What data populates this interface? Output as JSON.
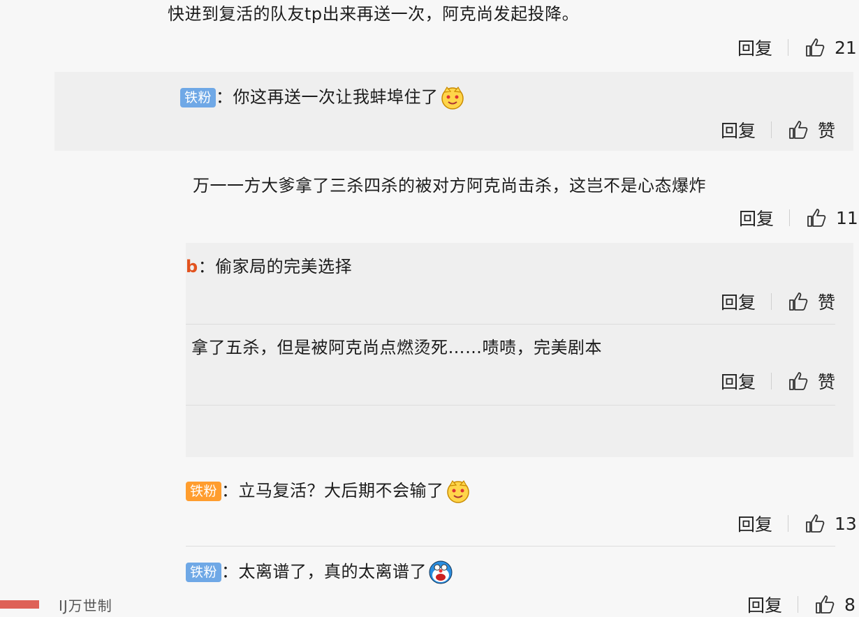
{
  "comments": [
    {
      "text": "快进到复活的队友tp出来再送一次，阿克尚发起投降。",
      "reply": "回复",
      "likes": "21"
    },
    {
      "badge": "铁粉",
      "text": "：你这再送一次让我蚌埠住了",
      "reply": "回复",
      "likes": "赞"
    },
    {
      "text": "万一一方大爹拿了三杀四杀的被对方阿克尚击杀，这岂不是心态爆炸",
      "reply": "回复",
      "likes": "11"
    },
    {
      "prefix": "b",
      "text": "：偷家局的完美选择",
      "reply": "回复",
      "likes": "赞"
    },
    {
      "text": "拿了五杀，但是被阿克尚点燃烫死……啧啧，完美剧本",
      "reply": "回复",
      "likes": "赞"
    },
    {
      "badge": "铁粉",
      "text": "：立马复活？大后期不会输了",
      "reply": "回复",
      "likes": "13"
    },
    {
      "badge": "铁粉",
      "text": "：太离谱了，真的太离谱了",
      "reply": "回复",
      "likes": "8"
    }
  ],
  "footer_text": "IJ万世制",
  "icons": {
    "like": "thumbs-up-icon",
    "emoji_smile": "cat-face-emoji",
    "emoji_cry": "doraemon-emoji"
  },
  "colors": {
    "badge_blue": "#6fa8e6",
    "badge_orange": "#ff9d2e",
    "panel": "#efefef"
  }
}
